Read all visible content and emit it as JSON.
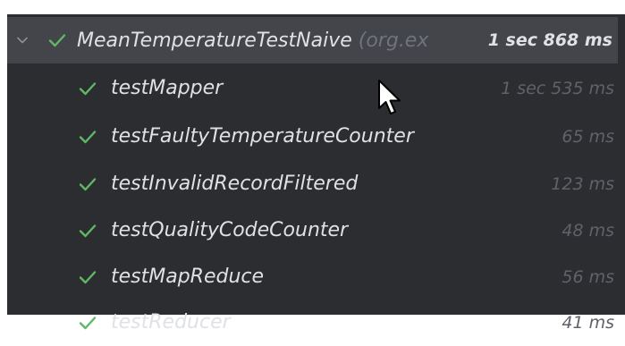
{
  "suite": {
    "name": "MeanTemperatureTestNaive",
    "package": "(org.ex",
    "duration": "1 sec 868 ms",
    "status": "passed"
  },
  "tests": [
    {
      "name": "testMapper",
      "duration": "1 sec 535 ms",
      "status": "passed"
    },
    {
      "name": "testFaultyTemperatureCounter",
      "duration": "65 ms",
      "status": "passed"
    },
    {
      "name": "testInvalidRecordFiltered",
      "duration": "123 ms",
      "status": "passed"
    },
    {
      "name": "testQualityCodeCounter",
      "duration": "48 ms",
      "status": "passed"
    },
    {
      "name": "testMapReduce",
      "duration": "56 ms",
      "status": "passed"
    },
    {
      "name": "testReducer",
      "duration": "41 ms",
      "status": "passed"
    }
  ],
  "colors": {
    "pass_check": "#5fb865",
    "background": "#2b2d30",
    "selected_row": "#43454a"
  }
}
